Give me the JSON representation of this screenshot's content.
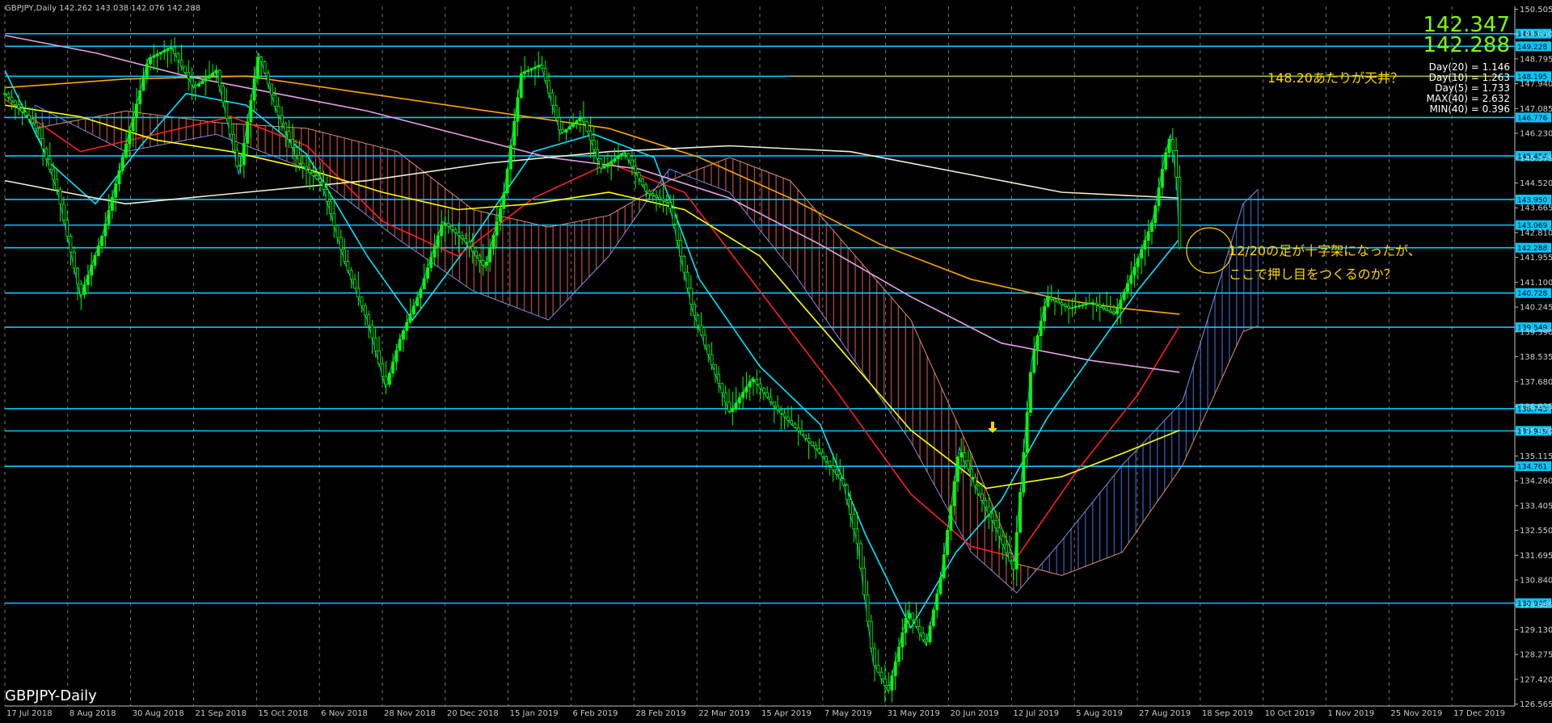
{
  "header": {
    "symbol_line": "GBPJPY,Daily  142.262 143.038 142.076 142.288",
    "title_bottom": "GBPJPY-Daily"
  },
  "price_display": {
    "bid": "142.347",
    "ask": "142.288",
    "stats": [
      "Day(20) = 1.146",
      "Day(10) = 1.263",
      "Day(5) = 1.733",
      "MAX(40) = 2.632",
      "MIN(40) = 0.396"
    ]
  },
  "annotations": {
    "top_question": "148.20あたりが天井？",
    "doji_line1": "12/20の足が十字架になったが、",
    "doji_line2": "ここで押し目をつくるのか？"
  },
  "colors": {
    "background": "#000000",
    "candles": "#00ff00",
    "hline": "#00c8ff",
    "annotation": "#ffd700",
    "price_big": "#7fff00",
    "ma_yellow": "#ffff00",
    "ma_red": "#ff2020",
    "ma_cyan": "#00e5ff",
    "ma_orange": "#ffa500",
    "ma_pink": "#e8a0e8",
    "ma_white": "#f0f0d0",
    "kumo_bull": "#4060c0",
    "kumo_bear": "#c05040",
    "vline_marker": "#ff0000"
  },
  "chart_data": {
    "type": "line",
    "title": "GBPJPY-Daily",
    "y_axis_range": [
      126.5,
      150.6
    ],
    "price_axis_ticks": [
      "150.505",
      "149.650",
      "148.795",
      "147.940",
      "147.085",
      "146.230",
      "145.375",
      "144.520",
      "143.665",
      "142.810",
      "141.955",
      "141.100",
      "140.245",
      "139.390",
      "138.535",
      "137.680",
      "136.825",
      "135.970",
      "135.115",
      "134.260",
      "133.405",
      "132.550",
      "131.695",
      "130.840",
      "129.985",
      "129.130",
      "128.275",
      "127.420",
      "126.565"
    ],
    "x_axis_labels": [
      "17 Jul 2018",
      "8 Aug 2018",
      "30 Aug 2018",
      "21 Sep 2018",
      "15 Oct 2018",
      "6 Nov 2018",
      "28 Nov 2018",
      "20 Dec 2018",
      "15 Jan 2019",
      "6 Feb 2019",
      "28 Feb 2019",
      "22 Mar 2019",
      "15 Apr 2019",
      "7 May 2019",
      "31 May 2019",
      "20 Jun 2019",
      "12 Jul 2019",
      "5 Aug 2019",
      "27 Aug 2019",
      "18 Sep 2019",
      "10 Oct 2019",
      "1 Nov 2019",
      "25 Nov 2019",
      "17 Dec 2019"
    ],
    "highlighted_date": "2019.05.31 00:00",
    "horizontal_levels": [
      {
        "price": 149.661,
        "label": "149.661"
      },
      {
        "price": 149.228,
        "label": "149.228"
      },
      {
        "price": 148.195,
        "label": "148.195"
      },
      {
        "price": 146.776,
        "label": "146.776"
      },
      {
        "price": 145.454,
        "label": "145.454"
      },
      {
        "price": 143.95,
        "label": "143.950"
      },
      {
        "price": 143.069,
        "label": "143.069"
      },
      {
        "price": 142.288,
        "label": "142.288"
      },
      {
        "price": 140.728,
        "label": "140.728"
      },
      {
        "price": 139.549,
        "label": "139.549"
      },
      {
        "price": 136.743,
        "label": "136.743"
      },
      {
        "price": 135.979,
        "label": "135.979"
      },
      {
        "price": 134.761,
        "label": "134.761"
      },
      {
        "price": 130.045,
        "label": "130.045"
      }
    ],
    "price_path": [
      {
        "x": 0.0,
        "y": 147.6
      },
      {
        "x": 0.02,
        "y": 146.5
      },
      {
        "x": 0.035,
        "y": 144.2
      },
      {
        "x": 0.05,
        "y": 140.6
      },
      {
        "x": 0.065,
        "y": 142.8
      },
      {
        "x": 0.08,
        "y": 145.8
      },
      {
        "x": 0.095,
        "y": 148.8
      },
      {
        "x": 0.11,
        "y": 149.2
      },
      {
        "x": 0.125,
        "y": 147.8
      },
      {
        "x": 0.14,
        "y": 148.4
      },
      {
        "x": 0.155,
        "y": 144.8
      },
      {
        "x": 0.168,
        "y": 149.0
      },
      {
        "x": 0.18,
        "y": 147.0
      },
      {
        "x": 0.195,
        "y": 145.2
      },
      {
        "x": 0.21,
        "y": 144.5
      },
      {
        "x": 0.225,
        "y": 141.8
      },
      {
        "x": 0.24,
        "y": 139.8
      },
      {
        "x": 0.252,
        "y": 137.5
      },
      {
        "x": 0.262,
        "y": 139.2
      },
      {
        "x": 0.275,
        "y": 140.8
      },
      {
        "x": 0.29,
        "y": 143.2
      },
      {
        "x": 0.305,
        "y": 142.5
      },
      {
        "x": 0.318,
        "y": 141.6
      },
      {
        "x": 0.33,
        "y": 144.0
      },
      {
        "x": 0.342,
        "y": 148.3
      },
      {
        "x": 0.355,
        "y": 148.6
      },
      {
        "x": 0.368,
        "y": 146.2
      },
      {
        "x": 0.382,
        "y": 146.8
      },
      {
        "x": 0.395,
        "y": 145.0
      },
      {
        "x": 0.41,
        "y": 145.6
      },
      {
        "x": 0.425,
        "y": 144.2
      },
      {
        "x": 0.44,
        "y": 143.8
      },
      {
        "x": 0.455,
        "y": 140.2
      },
      {
        "x": 0.47,
        "y": 138.0
      },
      {
        "x": 0.48,
        "y": 136.6
      },
      {
        "x": 0.495,
        "y": 137.8
      },
      {
        "x": 0.51,
        "y": 136.8
      },
      {
        "x": 0.525,
        "y": 136.0
      },
      {
        "x": 0.54,
        "y": 135.2
      },
      {
        "x": 0.555,
        "y": 134.2
      },
      {
        "x": 0.565,
        "y": 132.0
      },
      {
        "x": 0.575,
        "y": 128.0
      },
      {
        "x": 0.585,
        "y": 127.0
      },
      {
        "x": 0.598,
        "y": 129.8
      },
      {
        "x": 0.61,
        "y": 128.6
      },
      {
        "x": 0.62,
        "y": 131.0
      },
      {
        "x": 0.632,
        "y": 135.4
      },
      {
        "x": 0.645,
        "y": 133.8
      },
      {
        "x": 0.655,
        "y": 132.8
      },
      {
        "x": 0.668,
        "y": 131.2
      },
      {
        "x": 0.68,
        "y": 138.4
      },
      {
        "x": 0.69,
        "y": 140.6
      },
      {
        "x": 0.705,
        "y": 140.2
      },
      {
        "x": 0.72,
        "y": 140.4
      },
      {
        "x": 0.735,
        "y": 140.0
      },
      {
        "x": 0.748,
        "y": 141.6
      },
      {
        "x": 0.76,
        "y": 143.2
      },
      {
        "x": 0.768,
        "y": 145.4
      },
      {
        "x": 0.772,
        "y": 146.2
      },
      {
        "x": 0.776,
        "y": 144.6
      },
      {
        "x": 0.778,
        "y": 142.3
      }
    ],
    "series": [
      {
        "name": "",
        "color": "#00e5ff",
        "points": [
          {
            "x": 0.0,
            "y": 148.4
          },
          {
            "x": 0.03,
            "y": 145.2
          },
          {
            "x": 0.06,
            "y": 143.8
          },
          {
            "x": 0.09,
            "y": 145.8
          },
          {
            "x": 0.12,
            "y": 147.6
          },
          {
            "x": 0.16,
            "y": 147.2
          },
          {
            "x": 0.2,
            "y": 145.5
          },
          {
            "x": 0.24,
            "y": 142.0
          },
          {
            "x": 0.27,
            "y": 139.8
          },
          {
            "x": 0.31,
            "y": 142.6
          },
          {
            "x": 0.35,
            "y": 145.6
          },
          {
            "x": 0.39,
            "y": 146.2
          },
          {
            "x": 0.43,
            "y": 145.4
          },
          {
            "x": 0.46,
            "y": 141.2
          },
          {
            "x": 0.5,
            "y": 138.2
          },
          {
            "x": 0.54,
            "y": 136.2
          },
          {
            "x": 0.57,
            "y": 132.4
          },
          {
            "x": 0.6,
            "y": 129.2
          },
          {
            "x": 0.63,
            "y": 131.8
          },
          {
            "x": 0.66,
            "y": 133.6
          },
          {
            "x": 0.69,
            "y": 136.4
          },
          {
            "x": 0.72,
            "y": 138.6
          },
          {
            "x": 0.75,
            "y": 140.8
          },
          {
            "x": 0.778,
            "y": 142.6
          }
        ]
      },
      {
        "name": "",
        "color": "#ff2020",
        "points": [
          {
            "x": 0.0,
            "y": 147.4
          },
          {
            "x": 0.05,
            "y": 145.6
          },
          {
            "x": 0.1,
            "y": 146.2
          },
          {
            "x": 0.15,
            "y": 146.8
          },
          {
            "x": 0.2,
            "y": 145.8
          },
          {
            "x": 0.25,
            "y": 143.2
          },
          {
            "x": 0.3,
            "y": 142.0
          },
          {
            "x": 0.35,
            "y": 144.0
          },
          {
            "x": 0.4,
            "y": 145.2
          },
          {
            "x": 0.45,
            "y": 144.2
          },
          {
            "x": 0.5,
            "y": 140.8
          },
          {
            "x": 0.55,
            "y": 137.4
          },
          {
            "x": 0.6,
            "y": 133.8
          },
          {
            "x": 0.64,
            "y": 132.0
          },
          {
            "x": 0.67,
            "y": 131.6
          },
          {
            "x": 0.71,
            "y": 134.6
          },
          {
            "x": 0.75,
            "y": 137.2
          },
          {
            "x": 0.778,
            "y": 139.6
          }
        ]
      },
      {
        "name": "",
        "color": "#ffff00",
        "points": [
          {
            "x": 0.0,
            "y": 147.2
          },
          {
            "x": 0.05,
            "y": 146.8
          },
          {
            "x": 0.1,
            "y": 146.0
          },
          {
            "x": 0.15,
            "y": 145.6
          },
          {
            "x": 0.2,
            "y": 145.0
          },
          {
            "x": 0.25,
            "y": 144.2
          },
          {
            "x": 0.3,
            "y": 143.6
          },
          {
            "x": 0.35,
            "y": 143.8
          },
          {
            "x": 0.4,
            "y": 144.2
          },
          {
            "x": 0.45,
            "y": 143.6
          },
          {
            "x": 0.5,
            "y": 142.0
          },
          {
            "x": 0.55,
            "y": 139.0
          },
          {
            "x": 0.6,
            "y": 136.0
          },
          {
            "x": 0.65,
            "y": 134.0
          },
          {
            "x": 0.7,
            "y": 134.4
          },
          {
            "x": 0.74,
            "y": 135.2
          },
          {
            "x": 0.778,
            "y": 136.0
          }
        ]
      },
      {
        "name": "",
        "color": "#ffa500",
        "points": [
          {
            "x": 0.0,
            "y": 147.8
          },
          {
            "x": 0.08,
            "y": 148.1
          },
          {
            "x": 0.16,
            "y": 148.2
          },
          {
            "x": 0.24,
            "y": 147.6
          },
          {
            "x": 0.32,
            "y": 147.0
          },
          {
            "x": 0.4,
            "y": 146.4
          },
          {
            "x": 0.46,
            "y": 145.4
          },
          {
            "x": 0.52,
            "y": 144.0
          },
          {
            "x": 0.58,
            "y": 142.4
          },
          {
            "x": 0.64,
            "y": 141.2
          },
          {
            "x": 0.7,
            "y": 140.5
          },
          {
            "x": 0.74,
            "y": 140.2
          },
          {
            "x": 0.778,
            "y": 140.0
          }
        ]
      },
      {
        "name": "",
        "color": "#e8a0e8",
        "points": [
          {
            "x": 0.0,
            "y": 149.6
          },
          {
            "x": 0.06,
            "y": 149.0
          },
          {
            "x": 0.12,
            "y": 148.2
          },
          {
            "x": 0.18,
            "y": 147.6
          },
          {
            "x": 0.24,
            "y": 147.0
          },
          {
            "x": 0.3,
            "y": 146.2
          },
          {
            "x": 0.36,
            "y": 145.4
          },
          {
            "x": 0.42,
            "y": 145.0
          },
          {
            "x": 0.48,
            "y": 144.0
          },
          {
            "x": 0.54,
            "y": 142.4
          },
          {
            "x": 0.6,
            "y": 140.6
          },
          {
            "x": 0.66,
            "y": 139.0
          },
          {
            "x": 0.72,
            "y": 138.4
          },
          {
            "x": 0.778,
            "y": 138.0
          }
        ]
      },
      {
        "name": "",
        "color": "#f0f0d0",
        "points": [
          {
            "x": 0.0,
            "y": 144.6
          },
          {
            "x": 0.08,
            "y": 143.8
          },
          {
            "x": 0.16,
            "y": 144.2
          },
          {
            "x": 0.24,
            "y": 144.6
          },
          {
            "x": 0.32,
            "y": 145.2
          },
          {
            "x": 0.4,
            "y": 145.6
          },
          {
            "x": 0.48,
            "y": 145.8
          },
          {
            "x": 0.56,
            "y": 145.6
          },
          {
            "x": 0.64,
            "y": 144.8
          },
          {
            "x": 0.7,
            "y": 144.2
          },
          {
            "x": 0.778,
            "y": 144.0
          }
        ]
      }
    ],
    "kumo": {
      "span_a": [
        {
          "x": 0.02,
          "y": 147.2
        },
        {
          "x": 0.08,
          "y": 145.6
        },
        {
          "x": 0.14,
          "y": 146.2
        },
        {
          "x": 0.2,
          "y": 145.0
        },
        {
          "x": 0.26,
          "y": 142.6
        },
        {
          "x": 0.31,
          "y": 140.8
        },
        {
          "x": 0.36,
          "y": 139.8
        },
        {
          "x": 0.4,
          "y": 142.0
        },
        {
          "x": 0.44,
          "y": 145.0
        },
        {
          "x": 0.48,
          "y": 144.2
        },
        {
          "x": 0.52,
          "y": 141.6
        },
        {
          "x": 0.56,
          "y": 138.6
        },
        {
          "x": 0.6,
          "y": 135.6
        },
        {
          "x": 0.64,
          "y": 131.8
        },
        {
          "x": 0.67,
          "y": 130.4
        },
        {
          "x": 0.7,
          "y": 132.2
        },
        {
          "x": 0.74,
          "y": 134.8
        },
        {
          "x": 0.78,
          "y": 137.0
        },
        {
          "x": 0.82,
          "y": 143.8
        },
        {
          "x": 0.83,
          "y": 144.3
        }
      ],
      "span_b": [
        {
          "x": 0.02,
          "y": 146.4
        },
        {
          "x": 0.08,
          "y": 147.0
        },
        {
          "x": 0.14,
          "y": 146.6
        },
        {
          "x": 0.2,
          "y": 146.4
        },
        {
          "x": 0.26,
          "y": 145.6
        },
        {
          "x": 0.31,
          "y": 143.6
        },
        {
          "x": 0.36,
          "y": 143.0
        },
        {
          "x": 0.4,
          "y": 143.4
        },
        {
          "x": 0.44,
          "y": 144.6
        },
        {
          "x": 0.48,
          "y": 145.4
        },
        {
          "x": 0.52,
          "y": 144.6
        },
        {
          "x": 0.56,
          "y": 142.2
        },
        {
          "x": 0.6,
          "y": 139.8
        },
        {
          "x": 0.64,
          "y": 135.2
        },
        {
          "x": 0.67,
          "y": 131.4
        },
        {
          "x": 0.7,
          "y": 131.0
        },
        {
          "x": 0.74,
          "y": 131.8
        },
        {
          "x": 0.78,
          "y": 134.8
        },
        {
          "x": 0.82,
          "y": 139.4
        },
        {
          "x": 0.83,
          "y": 139.6
        }
      ]
    }
  }
}
